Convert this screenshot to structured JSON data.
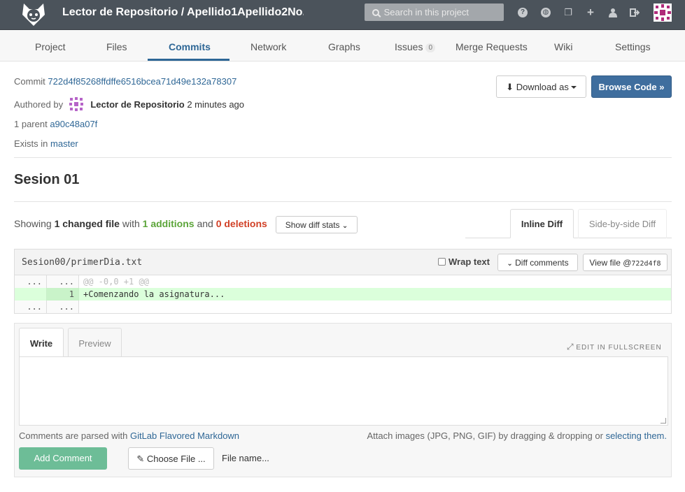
{
  "header": {
    "title": "Lector de Repositorio / Apellido1Apellido2No...",
    "search_placeholder": "Search in this project",
    "icons": [
      "help-icon",
      "globe-icon",
      "copy-icon",
      "plus-icon",
      "user-icon",
      "signout-icon"
    ]
  },
  "nav": {
    "items": [
      {
        "label": "Project"
      },
      {
        "label": "Files"
      },
      {
        "label": "Commits"
      },
      {
        "label": "Network"
      },
      {
        "label": "Graphs"
      },
      {
        "label": "Issues",
        "badge": "0"
      },
      {
        "label": "Merge Requests"
      },
      {
        "label": "Wiki"
      },
      {
        "label": "Settings"
      }
    ],
    "active": "Commits"
  },
  "commit": {
    "label": "Commit",
    "sha": "722d4f85268ffdffe6516bcea71d49e132a78307",
    "authored_label": "Authored by",
    "author": "Lector de Repositorio",
    "time": "2 minutes ago",
    "parent_label": "1 parent",
    "parent_sha": "a90c48a07f",
    "exists_label": "Exists in",
    "branch": "master",
    "title": "Sesion 01"
  },
  "actions": {
    "download": "Download as",
    "browse": "Browse Code »"
  },
  "stats": {
    "showing": "Showing",
    "changed": "1 changed file",
    "with": "with",
    "additions": "1 additions",
    "and": "and",
    "deletions": "0 deletions",
    "show_diff_stats": "Show diff stats"
  },
  "diff_tabs": {
    "inline": "Inline Diff",
    "side": "Side-by-side Diff"
  },
  "file": {
    "name": "Sesion00/primerDia.txt",
    "wrap_text": "Wrap text",
    "diff_comments": "Diff comments",
    "view_file": "View file @",
    "view_file_sha": "722d4f8",
    "lines": [
      {
        "old": "...",
        "new": "...",
        "code": "@@ -0,0 +1 @@",
        "type": "meta"
      },
      {
        "old": "",
        "new": "1",
        "code": "+Comenzando la asignatura...",
        "type": "add"
      },
      {
        "old": "...",
        "new": "...",
        "code": "",
        "type": "context"
      }
    ]
  },
  "comment": {
    "tab_write": "Write",
    "tab_preview": "Preview",
    "fullscreen": "EDIT IN FULLSCREEN",
    "hint_prefix": "Comments are parsed with",
    "hint_link": "GitLab Flavored Markdown",
    "attach_prefix": "Attach images (JPG, PNG, GIF) by dragging & dropping or",
    "attach_link": "selecting them.",
    "add_button": "Add Comment",
    "choose_file": "Choose File ...",
    "file_name": "File name..."
  },
  "colors": {
    "header_bg": "#4b535b",
    "link": "#2f6796",
    "primary": "#3f6e9e",
    "additions": "#5ca53a",
    "deletions": "#d14026",
    "add_comment": "#6dbd97"
  }
}
